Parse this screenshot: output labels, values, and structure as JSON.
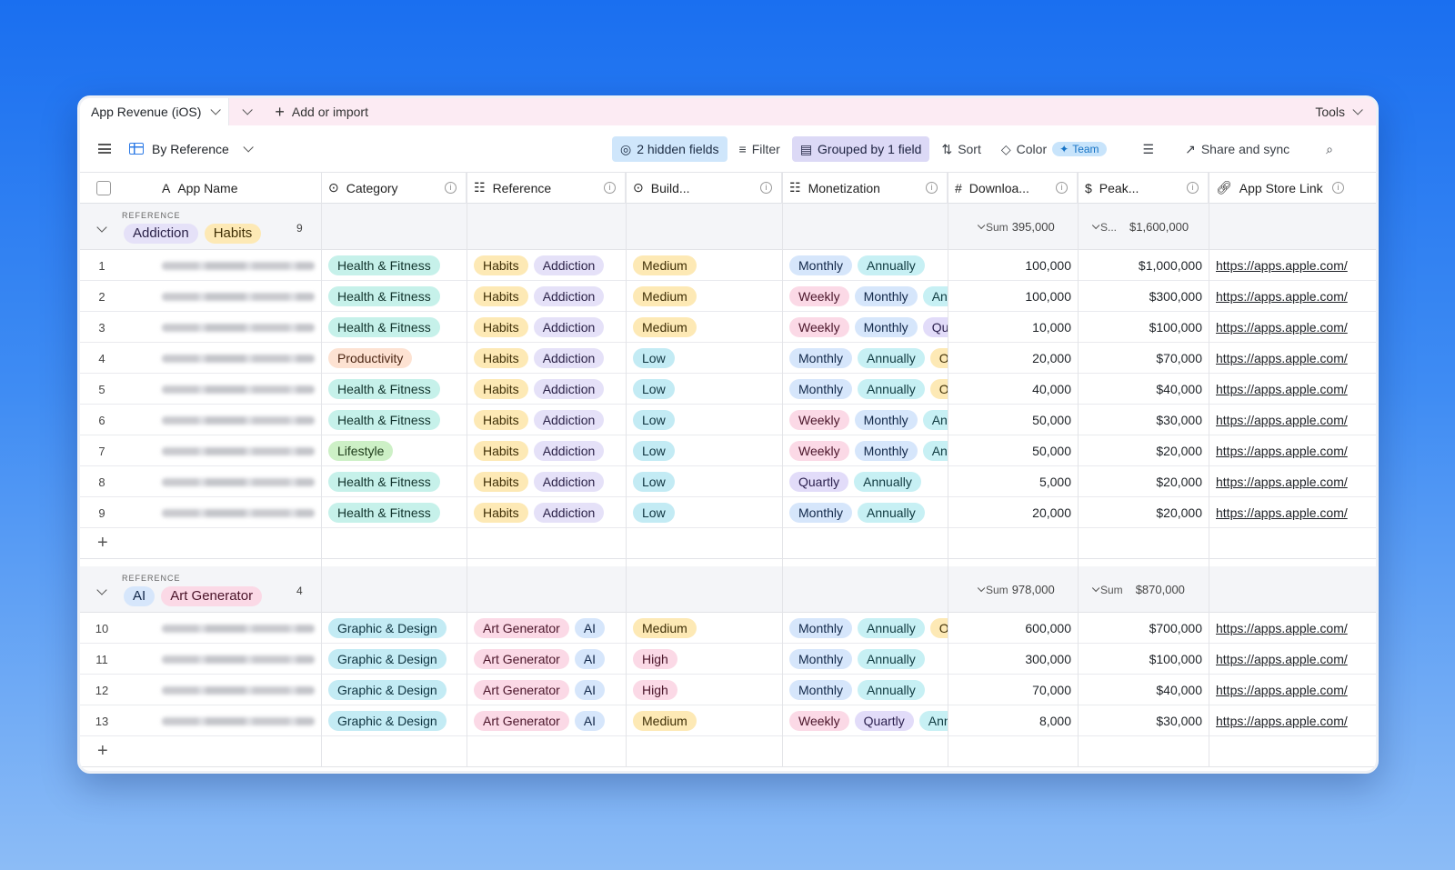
{
  "tabbar": {
    "title": "App Revenue (iOS)",
    "add_label": "Add or import",
    "tools_label": "Tools"
  },
  "toolbar": {
    "view_label": "By Reference",
    "hidden_fields": "2 hidden fields",
    "filter": "Filter",
    "grouped": "Grouped by 1 field",
    "sort": "Sort",
    "color": "Color",
    "team": "Team",
    "share": "Share and sync"
  },
  "columns": {
    "app_name": "App Name",
    "category": "Category",
    "reference": "Reference",
    "build": "Build...",
    "monetization": "Monetization",
    "downloads": "Downloa...",
    "peak": "Peak...",
    "link": "App Store Link"
  },
  "groups": [
    {
      "label": "REFERENCE",
      "tags": [
        "Addiction",
        "Habits"
      ],
      "count": "9",
      "sum_downloads": "395,000",
      "sum_peak_prefix": "S...",
      "sum_peak": "$1,600,000",
      "rows": [
        {
          "n": "1",
          "cat": "Health & Fitness",
          "ref": [
            "Habits",
            "Addiction"
          ],
          "build": "Medium",
          "mon": [
            "Monthly",
            "Annually"
          ],
          "dl": "100,000",
          "peak": "$1,000,000",
          "link": "https://apps.apple.com/"
        },
        {
          "n": "2",
          "cat": "Health & Fitness",
          "ref": [
            "Habits",
            "Addiction"
          ],
          "build": "Medium",
          "mon": [
            "Weekly",
            "Monthly",
            "Anı"
          ],
          "dl": "100,000",
          "peak": "$300,000",
          "link": "https://apps.apple.com/"
        },
        {
          "n": "3",
          "cat": "Health & Fitness",
          "ref": [
            "Habits",
            "Addiction"
          ],
          "build": "Medium",
          "mon": [
            "Weekly",
            "Monthly",
            "Qu"
          ],
          "dl": "10,000",
          "peak": "$100,000",
          "link": "https://apps.apple.com/"
        },
        {
          "n": "4",
          "cat": "Productivity",
          "ref": [
            "Habits",
            "Addiction"
          ],
          "build": "Low",
          "mon": [
            "Monthly",
            "Annually",
            "O"
          ],
          "dl": "20,000",
          "peak": "$70,000",
          "link": "https://apps.apple.com/"
        },
        {
          "n": "5",
          "cat": "Health & Fitness",
          "ref": [
            "Habits",
            "Addiction"
          ],
          "build": "Low",
          "mon": [
            "Monthly",
            "Annually",
            "O"
          ],
          "dl": "40,000",
          "peak": "$40,000",
          "link": "https://apps.apple.com/"
        },
        {
          "n": "6",
          "cat": "Health & Fitness",
          "ref": [
            "Habits",
            "Addiction"
          ],
          "build": "Low",
          "mon": [
            "Weekly",
            "Monthly",
            "Anı"
          ],
          "dl": "50,000",
          "peak": "$30,000",
          "link": "https://apps.apple.com/"
        },
        {
          "n": "7",
          "cat": "Lifestyle",
          "ref": [
            "Habits",
            "Addiction"
          ],
          "build": "Low",
          "mon": [
            "Weekly",
            "Monthly",
            "Anı"
          ],
          "dl": "50,000",
          "peak": "$20,000",
          "link": "https://apps.apple.com/"
        },
        {
          "n": "8",
          "cat": "Health & Fitness",
          "ref": [
            "Habits",
            "Addiction"
          ],
          "build": "Low",
          "mon": [
            "Quartly",
            "Annually"
          ],
          "dl": "5,000",
          "peak": "$20,000",
          "link": "https://apps.apple.com/"
        },
        {
          "n": "9",
          "cat": "Health & Fitness",
          "ref": [
            "Habits",
            "Addiction"
          ],
          "build": "Low",
          "mon": [
            "Monthly",
            "Annually"
          ],
          "dl": "20,000",
          "peak": "$20,000",
          "link": "https://apps.apple.com/"
        }
      ]
    },
    {
      "label": "REFERENCE",
      "tags": [
        "AI",
        "Art Generator"
      ],
      "count": "4",
      "sum_downloads": "978,000",
      "sum_peak_prefix": "Sum",
      "sum_peak": "$870,000",
      "rows": [
        {
          "n": "10",
          "cat": "Graphic & Design",
          "ref": [
            "Art Generator",
            "AI"
          ],
          "build": "Medium",
          "mon": [
            "Monthly",
            "Annually",
            "O"
          ],
          "dl": "600,000",
          "peak": "$700,000",
          "link": "https://apps.apple.com/"
        },
        {
          "n": "11",
          "cat": "Graphic & Design",
          "ref": [
            "Art Generator",
            "AI"
          ],
          "build": "High",
          "mon": [
            "Monthly",
            "Annually"
          ],
          "dl": "300,000",
          "peak": "$100,000",
          "link": "https://apps.apple.com/"
        },
        {
          "n": "12",
          "cat": "Graphic & Design",
          "ref": [
            "Art Generator",
            "AI"
          ],
          "build": "High",
          "mon": [
            "Monthly",
            "Annually"
          ],
          "dl": "70,000",
          "peak": "$40,000",
          "link": "https://apps.apple.com/"
        },
        {
          "n": "13",
          "cat": "Graphic & Design",
          "ref": [
            "Art Generator",
            "AI"
          ],
          "build": "Medium",
          "mon": [
            "Weekly",
            "Quartly",
            "Ann"
          ],
          "dl": "8,000",
          "peak": "$30,000",
          "link": "https://apps.apple.com/"
        }
      ]
    }
  ],
  "sum_label": "Sum",
  "colors": {
    "Health & Fitness": "c-green",
    "Productivity": "c-orange",
    "Lifestyle": "c-lime",
    "Graphic & Design": "c-cyan",
    "Habits": "c-yellow",
    "Addiction": "c-lav",
    "Art Generator": "c-pink",
    "AI": "c-blue",
    "Medium": "c-yellow",
    "Low": "c-cyan",
    "High": "c-pink",
    "Monthly": "c-blue",
    "Annually": "c-aqua",
    "Weekly": "c-pink",
    "Quartly": "c-purple",
    "Anı": "c-aqua",
    "Ann": "c-aqua",
    "Qu": "c-purple",
    "O": "c-yellow"
  }
}
